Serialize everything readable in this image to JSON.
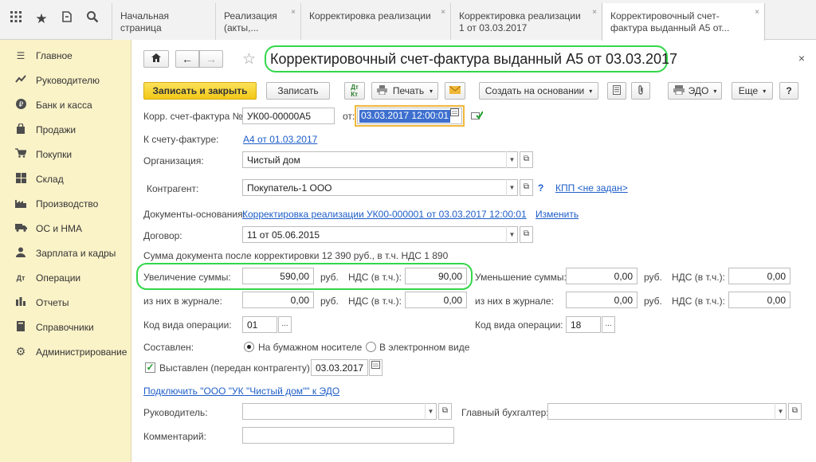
{
  "topbar": {
    "tabs": [
      {
        "label": "Начальная страница"
      },
      {
        "label": "Реализация (акты,..."
      },
      {
        "label": "Корректировка реализации"
      },
      {
        "label": "Корректировка реализации 1 от 03.03.2017"
      },
      {
        "label": "Корректировочный счет-фактура выданный А5 от..."
      }
    ],
    "tab_close": "×"
  },
  "sidebar": {
    "items": [
      {
        "label": "Главное",
        "icon": "menu-icon"
      },
      {
        "label": "Руководителю",
        "icon": "chart-line-icon"
      },
      {
        "label": "Банк и касса",
        "icon": "ruble-icon"
      },
      {
        "label": "Продажи",
        "icon": "bag-icon"
      },
      {
        "label": "Покупки",
        "icon": "cart-icon"
      },
      {
        "label": "Склад",
        "icon": "warehouse-icon"
      },
      {
        "label": "Производство",
        "icon": "factory-icon"
      },
      {
        "label": "ОС и НМА",
        "icon": "truck-icon"
      },
      {
        "label": "Зарплата и кадры",
        "icon": "person-icon"
      },
      {
        "label": "Операции",
        "icon": "dt-kt-icon"
      },
      {
        "label": "Отчеты",
        "icon": "bar-chart-icon"
      },
      {
        "label": "Справочники",
        "icon": "book-icon"
      },
      {
        "label": "Администрирование",
        "icon": "gear-icon"
      }
    ]
  },
  "form": {
    "title": "Корректировочный счет-фактура выданный А5 от 03.03.2017",
    "close": "×",
    "toolbar": {
      "save_close": "Записать и закрыть",
      "save": "Записать",
      "print": "Печать",
      "create_based": "Создать на основании",
      "edo": "ЭДО",
      "more": "Еще",
      "help": "?"
    },
    "fields": {
      "corr_invoice_label": "Корр. счет-фактура №:",
      "corr_invoice_value": "УК00-00000А5",
      "from_label": "от:",
      "from_value": "03.03.2017 12:00:01",
      "to_invoice_label": "К счету-фактуре:",
      "to_invoice_link": "А4 от 01.03.2017",
      "org_label": "Организация:",
      "org_value": "Чистый дом",
      "contractor_label": "Контрагент:",
      "contractor_value": "Покупатель-1 ООО",
      "kpp_help": "?",
      "kpp_link": "КПП <не задан>",
      "base_docs_label": "Документы-основания:",
      "base_docs_link": "Корректировка реализации УК00-000001 от 03.03.2017 12:00:01",
      "change_link": "Изменить",
      "contract_label": "Договор:",
      "contract_value": "11 от 05.06.2015",
      "doc_sum_text": "Сумма документа после корректировки 12 390 руб., в т.ч. НДС 1 890",
      "increase_label": "Увеличение суммы:",
      "increase_value": "590,00",
      "rub": "руб.",
      "vat_label": "НДС (в т.ч.):",
      "increase_vat": "90,00",
      "decrease_label": "Уменьшение суммы:",
      "decrease_value": "0,00",
      "decrease_vat": "0,00",
      "journal_label": "из них в журнале:",
      "journal_inc_value": "0,00",
      "journal_inc_vat": "0,00",
      "journal_dec_value": "0,00",
      "journal_dec_vat": "0,00",
      "op_code_label": "Код вида операции:",
      "op_code_left": "01",
      "op_code_right": "18",
      "ellipsis": "...",
      "composed_label": "Составлен:",
      "paper_option": "На бумажном носителе",
      "electronic_option": "В электронном виде",
      "issued_label": "Выставлен (передан контрагенту):",
      "issued_date": "03.03.2017",
      "edo_link": "Подключить \"ООО \"УК \"Чистый дом\"\" к ЭДО",
      "director_label": "Руководитель:",
      "director_value": "",
      "accountant_label": "Главный бухгалтер:",
      "accountant_value": "",
      "comment_label": "Комментарий:",
      "comment_value": ""
    }
  },
  "colors": {
    "sidebar_bg": "#fbf3c8",
    "primary_button": "#f3c817",
    "highlight": "#33d74a",
    "link": "#1e5ec8"
  }
}
